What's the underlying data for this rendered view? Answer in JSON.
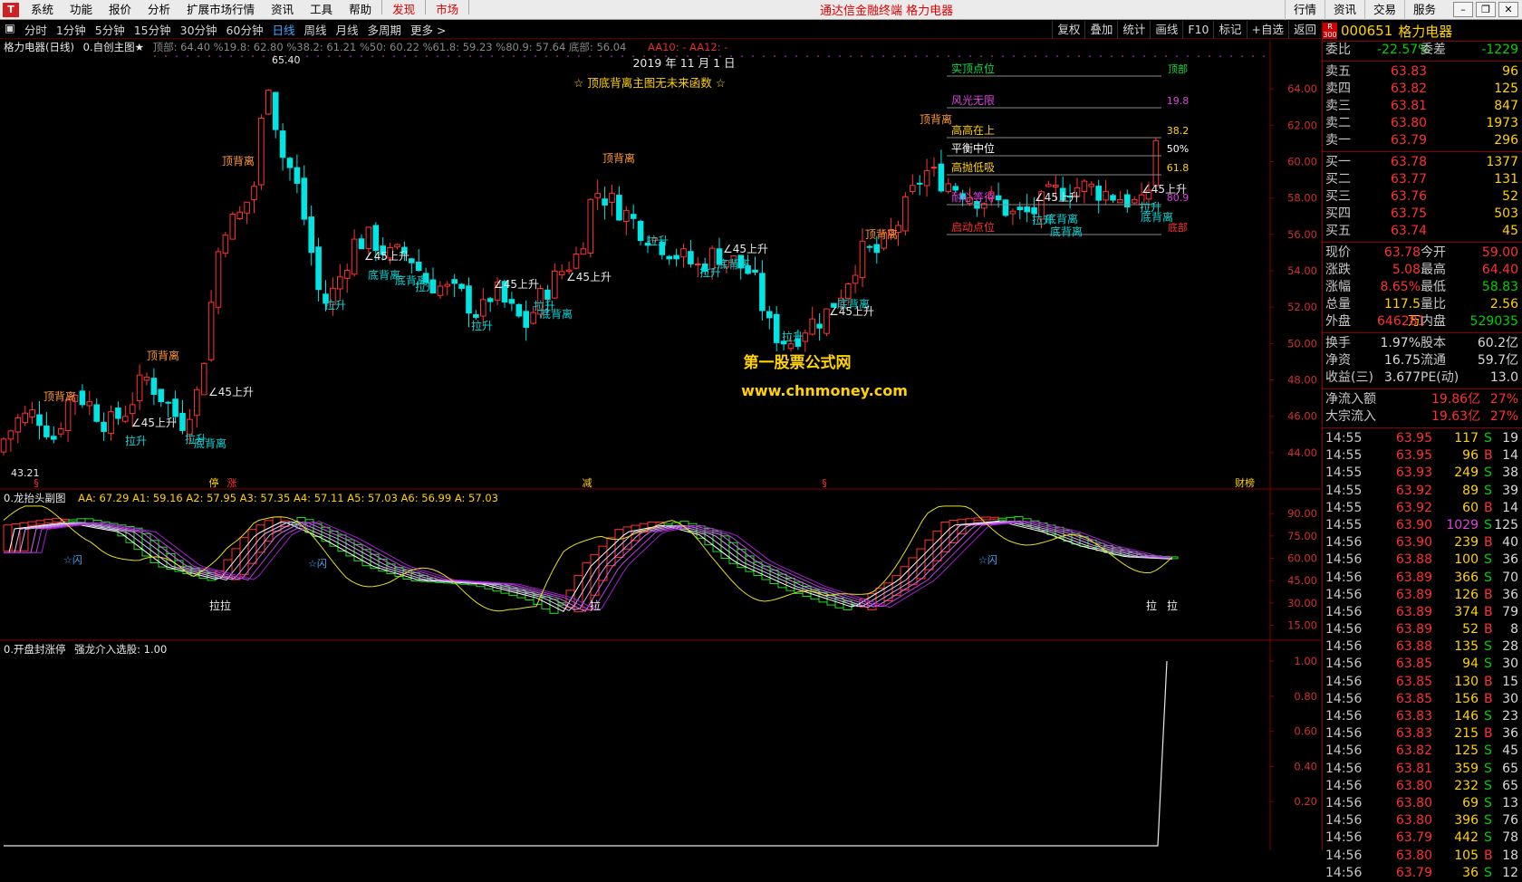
{
  "menubar": {
    "logo": "T",
    "items": [
      "系统",
      "功能",
      "报价",
      "分析",
      "扩展市场行情",
      "资讯",
      "工具",
      "帮助"
    ],
    "red_items": [
      "发现",
      "市场"
    ],
    "title": "通达信金融终端  格力电器",
    "right_items": [
      "行情",
      "资讯",
      "交易",
      "服务"
    ]
  },
  "toolbar": {
    "periods": [
      "分时",
      "1分钟",
      "5分钟",
      "15分钟",
      "30分钟",
      "60分钟",
      "日线",
      "周线",
      "月线",
      "多周期",
      "更多 >"
    ],
    "active": "日线",
    "right": [
      "复权",
      "叠加",
      "统计",
      "画线",
      "F10",
      "标记",
      "+自选",
      "返回"
    ]
  },
  "main_chart": {
    "status_title": "格力电器(日线)",
    "indicator": "0.自创主图★",
    "params": "顶部: 64.40  %19.8: 62.80  %38.2: 61.21  %50: 60.22  %61.8: 59.23  %80.9: 57.64  底部: 56.04",
    "aa": "AA10: -  AA12: -",
    "date_label": "2019 年 11 月 1 日",
    "note": "☆ 顶底背离主图无未来函数 ☆",
    "watermark1": "第一股票公式网",
    "watermark2": "www.chnmoney.com",
    "high_label": "65.40",
    "low_label": "43.21",
    "y_ticks": [
      "64.00",
      "62.00",
      "60.00",
      "58.00",
      "56.00",
      "54.00",
      "52.00",
      "50.00",
      "48.00",
      "46.00",
      "44.00"
    ],
    "levels": [
      "实顶点位",
      "风光无限",
      "高高在上",
      "平衡中位",
      "高抛低吸",
      "耐心等待",
      "启动点位"
    ],
    "level_right": [
      "顶部",
      "19.8",
      "38.2",
      "50%",
      "61.8",
      "80.9",
      "底部"
    ],
    "markers": {
      "top_div": "顶背离",
      "bottom_div": "底背离",
      "rise45": "∠45上升",
      "pull": "拉升",
      "bottom_marks": [
        "§",
        "停",
        "涨",
        "减",
        "§",
        "财榜"
      ]
    },
    "price_scale": {
      "min": 42.5,
      "max": 66.0
    }
  },
  "sub1": {
    "title": "0.龙抬头副图",
    "params_label": "AA: 67.29  A1: 59.16  A2: 57.95  A3: 57.35  A4: 57.11  A5: 57.03  A6: 56.99  A: 57.03",
    "y_ticks": [
      "90.00",
      "75.00",
      "60.00",
      "45.00",
      "30.00",
      "15.00"
    ],
    "flash": "☆闪",
    "labels": [
      "拉拉",
      "拉",
      "拉",
      "拉"
    ]
  },
  "sub2": {
    "title": "0.开盘封涨停",
    "params_label": "强龙介入选股: 1.00",
    "y_ticks": [
      "1.00",
      "0.80",
      "0.60",
      "0.40",
      "0.20"
    ]
  },
  "quote": {
    "code": "000651",
    "name": "格力电器",
    "badge": "R 300",
    "wei_bi": "委比",
    "wei_bi_val": "-22.57%",
    "wei_cha": "委差",
    "wei_cha_val": "-1229",
    "sells": [
      {
        "l": "卖五",
        "p": "63.83",
        "v": "96"
      },
      {
        "l": "卖四",
        "p": "63.82",
        "v": "125"
      },
      {
        "l": "卖三",
        "p": "63.81",
        "v": "847"
      },
      {
        "l": "卖二",
        "p": "63.80",
        "v": "1973"
      },
      {
        "l": "卖一",
        "p": "63.79",
        "v": "296"
      }
    ],
    "buys": [
      {
        "l": "买一",
        "p": "63.78",
        "v": "1377"
      },
      {
        "l": "买二",
        "p": "63.77",
        "v": "131"
      },
      {
        "l": "买三",
        "p": "63.76",
        "v": "52"
      },
      {
        "l": "买四",
        "p": "63.75",
        "v": "503"
      },
      {
        "l": "买五",
        "p": "63.74",
        "v": "45"
      }
    ],
    "stats": [
      [
        "现价",
        "63.78",
        "今开",
        "59.00"
      ],
      [
        "涨跌",
        "5.08",
        "最高",
        "64.40"
      ],
      [
        "涨幅",
        "8.65%",
        "最低",
        "58.83"
      ],
      [
        "总量",
        "117.5万",
        "量比",
        "2.56"
      ],
      [
        "外盘",
        "646281",
        "内盘",
        "529035"
      ]
    ],
    "stats2": [
      [
        "换手",
        "1.97%",
        "股本",
        "60.2亿"
      ],
      [
        "净资",
        "16.75",
        "流通",
        "59.7亿"
      ],
      [
        "收益(三)",
        "3.677",
        "PE(动)",
        "13.0"
      ]
    ],
    "flows": [
      [
        "净流入额",
        "19.86亿",
        "27%"
      ],
      [
        "大宗流入",
        "19.63亿",
        "27%"
      ]
    ],
    "ticks": [
      [
        "14:55",
        "63.95",
        "117",
        "S",
        "19"
      ],
      [
        "14:55",
        "63.95",
        "96",
        "B",
        "14"
      ],
      [
        "14:55",
        "63.93",
        "249",
        "S",
        "38"
      ],
      [
        "14:55",
        "63.92",
        "89",
        "S",
        "39"
      ],
      [
        "14:55",
        "63.92",
        "60",
        "B",
        "14"
      ],
      [
        "14:55",
        "63.90",
        "1029",
        "S",
        "125"
      ],
      [
        "14:56",
        "63.90",
        "239",
        "B",
        "40"
      ],
      [
        "14:56",
        "63.88",
        "100",
        "S",
        "36"
      ],
      [
        "14:56",
        "63.89",
        "366",
        "S",
        "70"
      ],
      [
        "14:56",
        "63.89",
        "126",
        "B",
        "36"
      ],
      [
        "14:56",
        "63.89",
        "374",
        "B",
        "79"
      ],
      [
        "14:56",
        "63.89",
        "52",
        "B",
        "8"
      ],
      [
        "14:56",
        "63.88",
        "135",
        "S",
        "28"
      ],
      [
        "14:56",
        "63.85",
        "94",
        "S",
        "30"
      ],
      [
        "14:56",
        "63.85",
        "130",
        "B",
        "15"
      ],
      [
        "14:56",
        "63.85",
        "156",
        "B",
        "30"
      ],
      [
        "14:56",
        "63.83",
        "146",
        "S",
        "23"
      ],
      [
        "14:56",
        "63.83",
        "215",
        "B",
        "36"
      ],
      [
        "14:56",
        "63.82",
        "125",
        "S",
        "45"
      ],
      [
        "14:56",
        "63.81",
        "359",
        "S",
        "65"
      ],
      [
        "14:56",
        "63.80",
        "232",
        "S",
        "65"
      ],
      [
        "14:56",
        "63.80",
        "69",
        "S",
        "13"
      ],
      [
        "14:56",
        "63.80",
        "396",
        "S",
        "76"
      ],
      [
        "14:56",
        "63.79",
        "442",
        "S",
        "78"
      ],
      [
        "14:56",
        "63.80",
        "105",
        "B",
        "18"
      ],
      [
        "14:56",
        "63.79",
        "36",
        "S",
        "12"
      ]
    ]
  },
  "colors": {
    "up": "#ff3232",
    "down": "#00e4e4",
    "grid": "#800000",
    "yellow": "#ffd200"
  }
}
